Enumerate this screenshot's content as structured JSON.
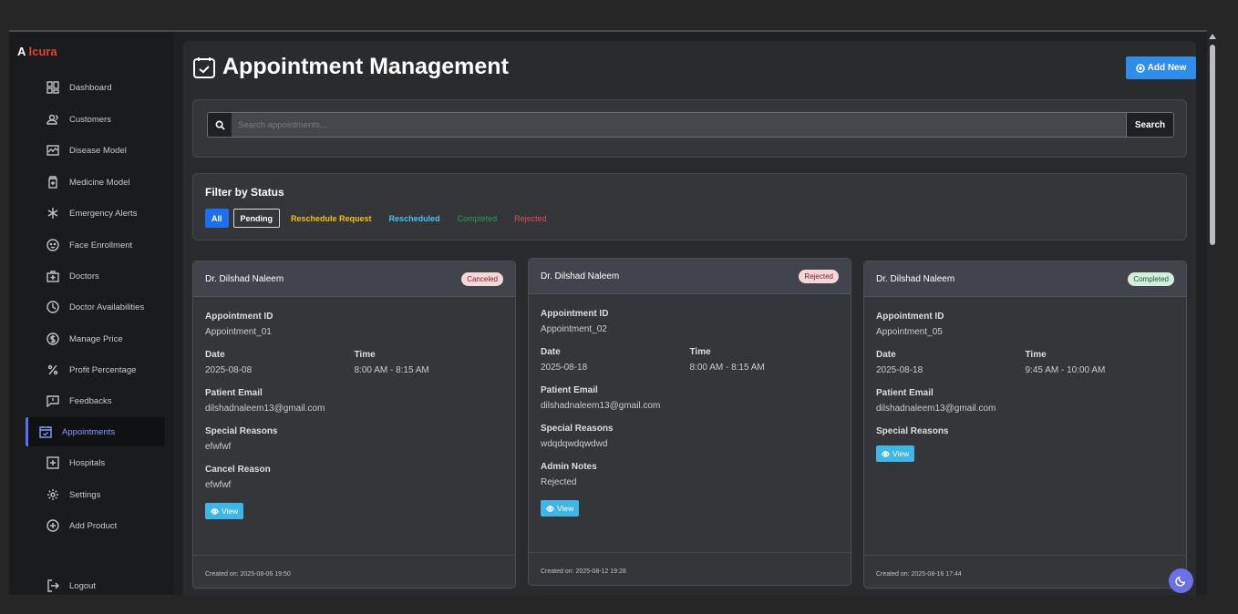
{
  "brand": {
    "prefix": "A ",
    "name": "lcura"
  },
  "sidebar": {
    "items": [
      {
        "label": "Dashboard",
        "icon": "dashboard-icon"
      },
      {
        "label": "Customers",
        "icon": "users-icon"
      },
      {
        "label": "Disease Model",
        "icon": "chart-icon"
      },
      {
        "label": "Medicine Model",
        "icon": "medicine-icon"
      },
      {
        "label": "Emergency Alerts",
        "icon": "asterisk-icon"
      },
      {
        "label": "Face Enrollment",
        "icon": "face-icon"
      },
      {
        "label": "Doctors",
        "icon": "doctor-icon"
      },
      {
        "label": "Doctor Availabilities",
        "icon": "clock-icon"
      },
      {
        "label": "Manage Price",
        "icon": "dollar-icon"
      },
      {
        "label": "Profit Percentage",
        "icon": "percent-icon"
      },
      {
        "label": "Feedbacks",
        "icon": "feedback-icon"
      },
      {
        "label": "Appointments",
        "icon": "calendar-check-icon"
      },
      {
        "label": "Hospitals",
        "icon": "hospital-icon"
      },
      {
        "label": "Settings",
        "icon": "gear-icon"
      },
      {
        "label": "Add Product",
        "icon": "plus-circle-icon"
      }
    ],
    "logout": "Logout",
    "active": "Appointments"
  },
  "header": {
    "title": "Appointment Management",
    "add_label": "Add New"
  },
  "search": {
    "placeholder": "Search appointments...",
    "button": "Search"
  },
  "filter": {
    "title": "Filter by Status",
    "options": [
      "All",
      "Pending",
      "Reschedule Request",
      "Rescheduled",
      "Completed",
      "Rejected"
    ],
    "selected": "All"
  },
  "cards": [
    {
      "doctor": "Dr. Dilshad Naleem",
      "status": "Canceled",
      "id_label": "Appointment ID",
      "id": "Appointment_01",
      "date_label": "Date",
      "date": "2025-08-08",
      "time_label": "Time",
      "time": "8:00 AM - 8:15 AM",
      "email_label": "Patient Email",
      "email": "dilshadnaleem13@gmail.com",
      "reasons_label": "Special Reasons",
      "reasons": "efwfwf",
      "extra_label": "Cancel Reason",
      "extra": "efwfwf",
      "view": "View",
      "created": "Created on: 2025-08-06 19:50"
    },
    {
      "doctor": "Dr. Dilshad Naleem",
      "status": "Rejected",
      "id_label": "Appointment ID",
      "id": "Appointment_02",
      "date_label": "Date",
      "date": "2025-08-18",
      "time_label": "Time",
      "time": "8:00 AM - 8:15 AM",
      "email_label": "Patient Email",
      "email": "dilshadnaleem13@gmail.com",
      "reasons_label": "Special Reasons",
      "reasons": "wdqdqwdqwdwd",
      "extra_label": "Admin Notes",
      "extra": "Rejected",
      "view": "View",
      "created": "Created on: 2025-08-12 19:28"
    },
    {
      "doctor": "Dr. Dilshad Naleem",
      "status": "Completed",
      "id_label": "Appointment ID",
      "id": "Appointment_05",
      "date_label": "Date",
      "date": "2025-08-18",
      "time_label": "Time",
      "time": "9:45 AM - 10:00 AM",
      "email_label": "Patient Email",
      "email": "dilshadnaleem13@gmail.com",
      "reasons_label": "Special Reasons",
      "view": "View",
      "created": "Created on: 2025-08-16 17:44"
    }
  ]
}
